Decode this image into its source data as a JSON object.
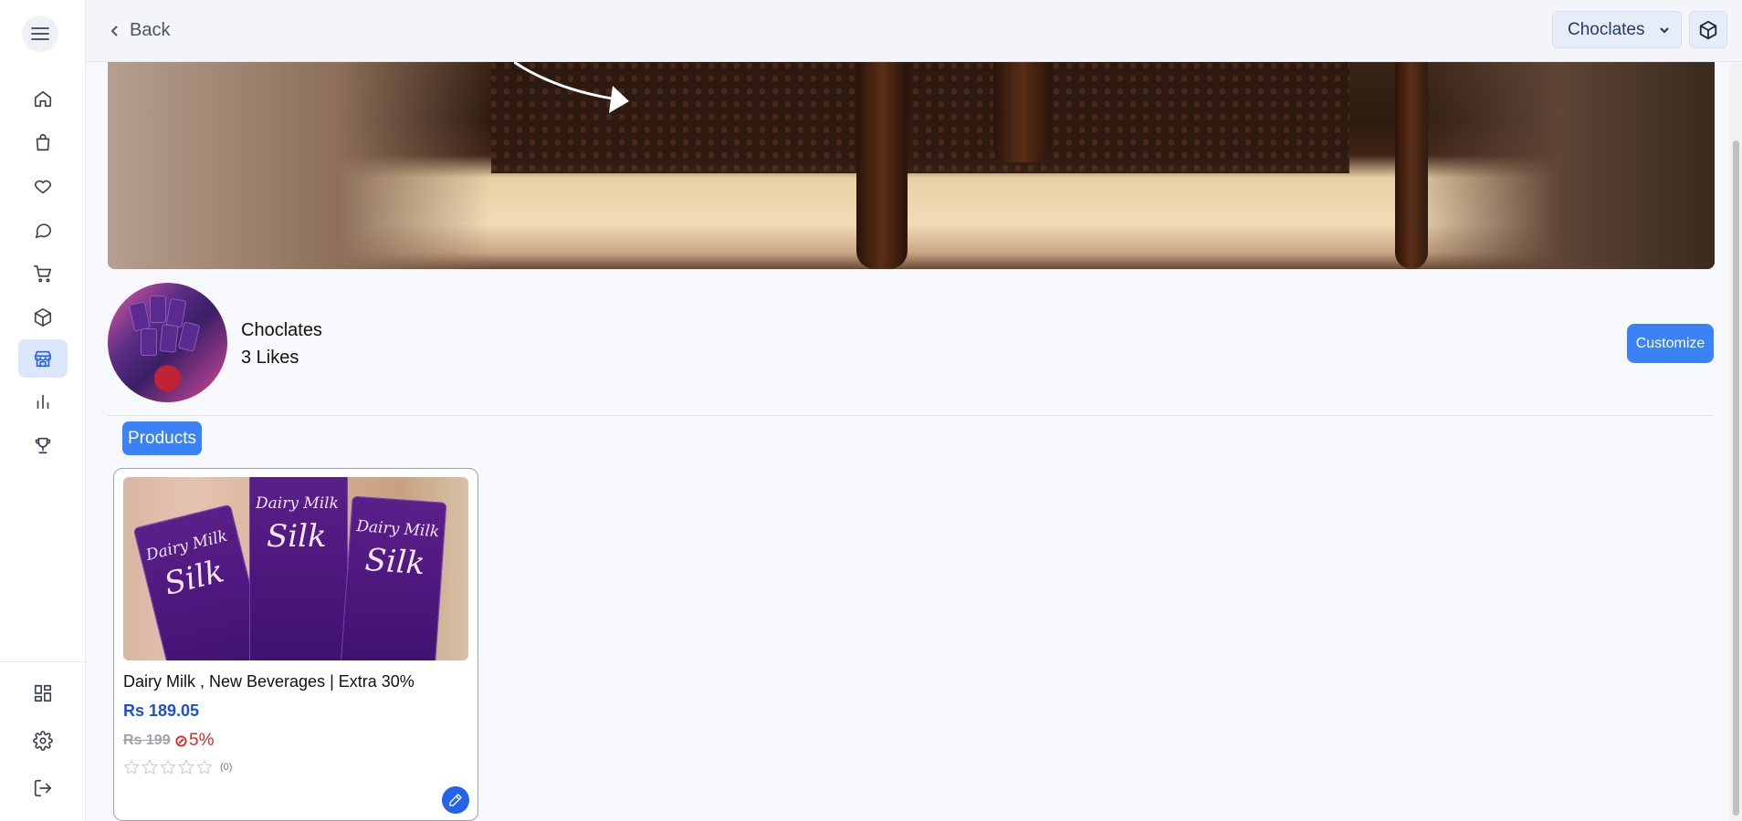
{
  "topbar": {
    "back_label": "Back",
    "store_select_value": "Choclates"
  },
  "sidebar": {
    "items": [
      {
        "name": "home",
        "icon": "home-icon"
      },
      {
        "name": "shop",
        "icon": "shopping-bag-icon"
      },
      {
        "name": "favorites",
        "icon": "heart-icon"
      },
      {
        "name": "messages",
        "icon": "chat-icon"
      },
      {
        "name": "cart",
        "icon": "cart-icon"
      },
      {
        "name": "products",
        "icon": "box-icon"
      },
      {
        "name": "store",
        "icon": "store-icon",
        "active": true
      },
      {
        "name": "analytics",
        "icon": "bar-chart-icon"
      },
      {
        "name": "rewards",
        "icon": "trophy-icon"
      }
    ],
    "bottom_items": [
      {
        "name": "dashboard",
        "icon": "grid-icon"
      },
      {
        "name": "settings",
        "icon": "gear-icon"
      },
      {
        "name": "logout",
        "icon": "logout-icon"
      }
    ]
  },
  "store": {
    "name": "Choclates",
    "likes": "3 Likes",
    "customize_label": "Customize"
  },
  "tabs": {
    "products_label": "Products"
  },
  "product": {
    "image_brand_text": "Dairy Milk",
    "image_sub_text": "Silk",
    "title": "Dairy Milk , New Beverages | Extra 30%",
    "price": "Rs 189.05",
    "old_price": "Rs 199",
    "discount": "5%",
    "rating": 0,
    "review_count": "(0)"
  },
  "colors": {
    "accent": "#3b82f6",
    "price": "#1d4ed8",
    "discount": "#dc2626",
    "active_nav_bg": "#dbe7fb"
  }
}
